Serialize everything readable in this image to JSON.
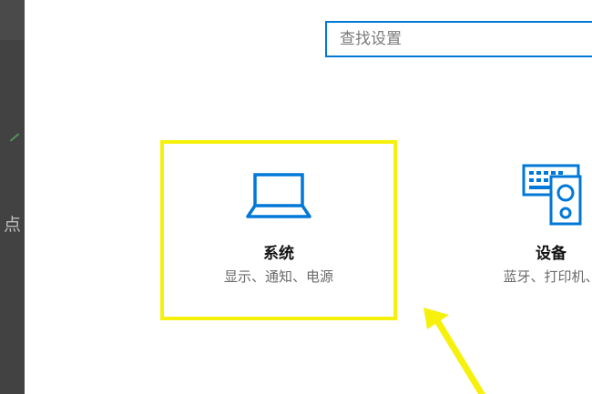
{
  "background_window": {
    "partial_char": "点"
  },
  "search": {
    "placeholder": "查找设置",
    "value": ""
  },
  "tiles": [
    {
      "title": "系统",
      "subtitle": "显示、通知、电源",
      "icon": "laptop-icon",
      "highlighted": true
    },
    {
      "title": "设备",
      "subtitle": "蓝牙、打印机、",
      "icon": "keyboard-speaker-icon",
      "highlighted": false
    }
  ],
  "colors": {
    "accent": "#0078d7",
    "highlight": "#f6f10c",
    "left_strip": "#424242"
  },
  "annotation": {
    "arrow": "yellow-arrow-icon"
  }
}
